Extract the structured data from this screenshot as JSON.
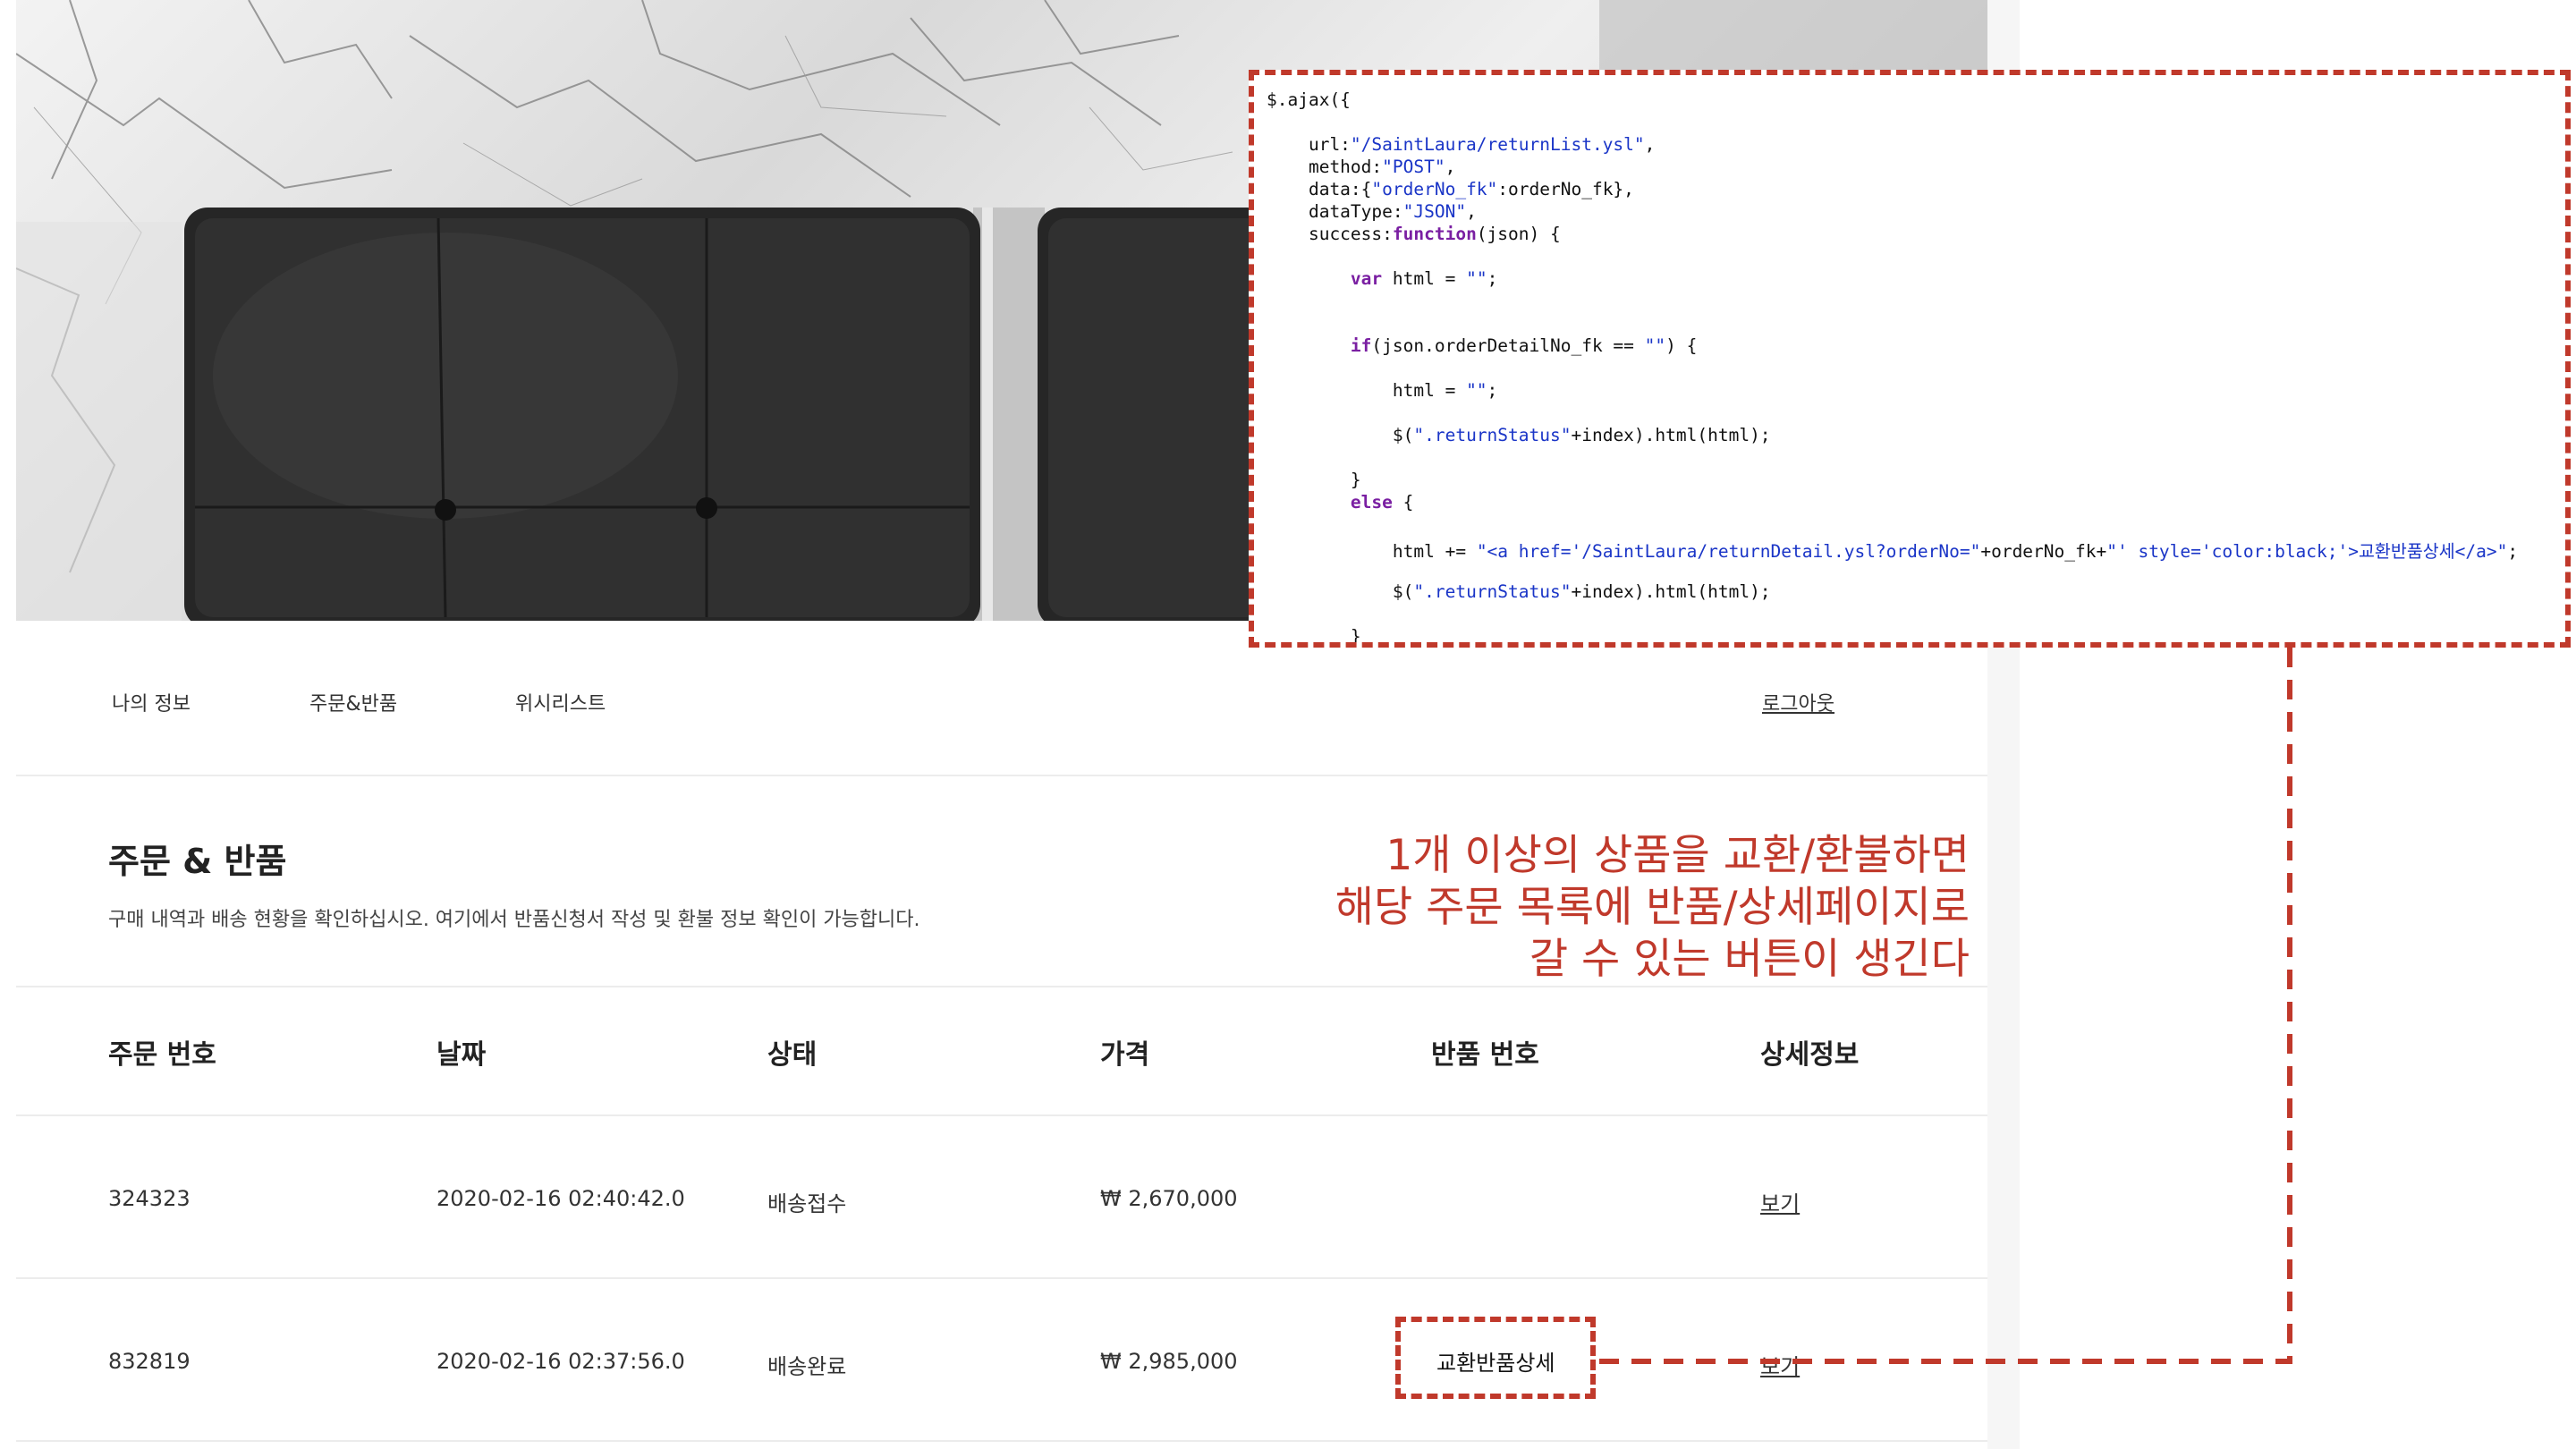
{
  "nav": {
    "items": [
      "나의 정보",
      "주문&반품",
      "위시리스트"
    ],
    "logout": "로그아웃"
  },
  "section": {
    "title": "주문 & 반품",
    "description": "구매 내역과 배송 현황을 확인하십시오. 여기에서 반품신청서 작성 및 환불 정보 확인이 가능합니다."
  },
  "table": {
    "headers": [
      "주문 번호",
      "날짜",
      "상태",
      "가격",
      "반품 번호",
      "상세정보"
    ],
    "rows": [
      {
        "order_no": "324323",
        "date": "2020-02-16 02:40:42.0",
        "status": "배송접수",
        "price": "₩ 2,670,000",
        "return_no": "",
        "detail": "보기"
      },
      {
        "order_no": "832819",
        "date": "2020-02-16 02:37:56.0",
        "status": "배송완료",
        "price": "₩ 2,985,000",
        "return_no": "교환반품상세",
        "detail": "보기"
      }
    ]
  },
  "code": {
    "lines": [
      "$.ajax({",
      "    url:\"/SaintLaura/returnList.ysl\",",
      "    method:\"POST\",",
      "    data:{\"orderNo_fk\":orderNo_fk},",
      "    dataType:\"JSON\",",
      "    success:function(json) {",
      "        var html = \"\";",
      "        if(json.orderDetailNo_fk == \"\") {",
      "            html = \"\";",
      "            $(\".returnStatus\"+index).html(html);",
      "        }",
      "        else {",
      "            html += \"<a href='/SaintLaura/returnDetail.ysl?orderNo=\"+orderNo_fk+\"' style='color:black;'>교환반품상세</a>\";",
      "            $(\".returnStatus\"+index).html(html);",
      "        }"
    ]
  },
  "annotation": {
    "lines": [
      "1개 이상의 상품을 교환/환불하면",
      "해당 주문 목록에 반품/상세페이지로",
      "갈 수 있는 버튼이 생긴다"
    ]
  },
  "colors": {
    "annotation": "#c0392b",
    "code_keyword": "#7a1fa2",
    "code_string": "#1a35c7",
    "divider": "#ececec"
  }
}
